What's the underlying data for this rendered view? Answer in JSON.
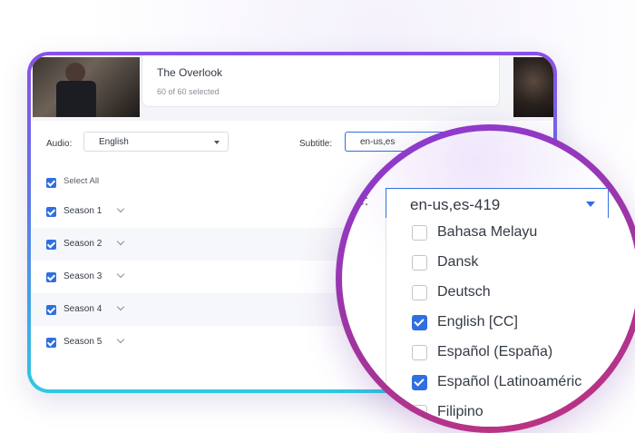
{
  "movie": {
    "title": "The Overlook",
    "selected_count": "60 of 60 selected"
  },
  "audio": {
    "label": "Audio:",
    "value": "English"
  },
  "subtitle": {
    "label": "Subtitle:",
    "value_small": "en-us,es",
    "value_zoomed": "en-us,es-419",
    "label_fragment": "e:"
  },
  "select_all": {
    "label": "Select All",
    "checked": true
  },
  "seasons": [
    {
      "label": "Season 1",
      "checked": true
    },
    {
      "label": "Season 2",
      "checked": true
    },
    {
      "label": "Season 3",
      "checked": true
    },
    {
      "label": "Season 4",
      "checked": true
    },
    {
      "label": "Season 5",
      "checked": true
    }
  ],
  "subtitle_options": [
    {
      "label": "Bahasa Melayu",
      "checked": false
    },
    {
      "label": "Dansk",
      "checked": false
    },
    {
      "label": "Deutsch",
      "checked": false
    },
    {
      "label": "English [CC]",
      "checked": true
    },
    {
      "label": "Español (España)",
      "checked": false
    },
    {
      "label": "Español (Latinoaméric",
      "checked": true
    },
    {
      "label": "Filipino",
      "checked": false
    }
  ],
  "colors": {
    "accent": "#2f6fe0",
    "frame_top": "#8a4fe8",
    "frame_bottom": "#2ec9e0",
    "lens_ring": "#a0359e"
  }
}
